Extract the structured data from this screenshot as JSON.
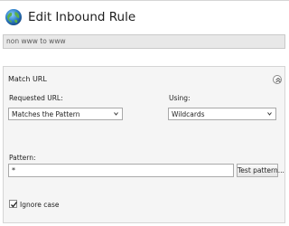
{
  "window": {
    "title": "Edit Inbound Rule",
    "icon": "globe-icon"
  },
  "rule_name": {
    "value": "non www to www"
  },
  "match_url": {
    "section_title": "Match URL",
    "collapse_icon": "collapse-chevron-icon",
    "requested_url": {
      "label": "Requested URL:",
      "selected": "Matches the Pattern"
    },
    "using": {
      "label": "Using:",
      "selected": "Wildcards"
    },
    "pattern": {
      "label": "Pattern:",
      "value": "*",
      "test_button_label": "Test pattern..."
    },
    "ignore_case": {
      "label": "Ignore case",
      "checked": true
    }
  },
  "colors": {
    "panel_bg": "#f5f5f5",
    "field_bg": "#e8e8e8",
    "globe_blue": "#2f7fc8"
  }
}
